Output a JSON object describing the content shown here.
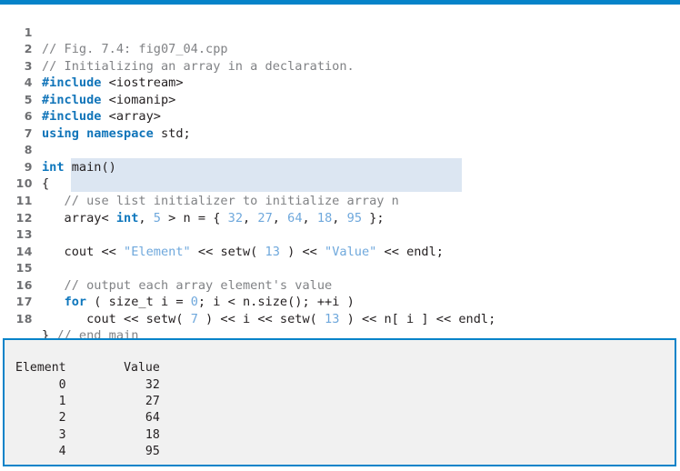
{
  "figure": {
    "caption_ref": "Fig. 7.4",
    "file_name": "fig07_04.cpp",
    "accent_color": "#0683c9",
    "highlight_color": "#dce6f2",
    "keyword_color": "#0f77bd",
    "comment_color": "#808285",
    "literal_color": "#6fa8dc",
    "output_bg_color": "#f1f1f1"
  },
  "code": {
    "line_numbers": [
      "1",
      "2",
      "3",
      "4",
      "5",
      "6",
      "7",
      "8",
      "9",
      "10",
      "11",
      "12",
      "13",
      "14",
      "15",
      "16",
      "17",
      "18"
    ],
    "lines": [
      {
        "n": "1",
        "text": "// Fig. 7.4: fig07_04.cpp"
      },
      {
        "n": "2",
        "text": "// Initializing an array in a declaration."
      },
      {
        "n": "3",
        "text": "#include <iostream>"
      },
      {
        "n": "4",
        "text": "#include <iomanip>"
      },
      {
        "n": "5",
        "text": "#include <array>"
      },
      {
        "n": "6",
        "text": "using namespace std;"
      },
      {
        "n": "7",
        "text": ""
      },
      {
        "n": "8",
        "text": "int main()"
      },
      {
        "n": "9",
        "text": "{"
      },
      {
        "n": "10",
        "text": "   // use list initializer to initialize array n"
      },
      {
        "n": "11",
        "text": "   array< int, 5 > n = { 32, 27, 64, 18, 95 };"
      },
      {
        "n": "12",
        "text": ""
      },
      {
        "n": "13",
        "text": "   cout << \"Element\" << setw( 13 ) << \"Value\" << endl;"
      },
      {
        "n": "14",
        "text": ""
      },
      {
        "n": "15",
        "text": "   // output each array element's value"
      },
      {
        "n": "16",
        "text": "   for ( size_t i = 0; i < n.size(); ++i )"
      },
      {
        "n": "17",
        "text": "      cout << setw( 7 ) << i << setw( 13 ) << n[ i ] << endl;"
      },
      {
        "n": "18",
        "text": "} // end main"
      }
    ],
    "highlighted_line_numbers": [
      "10",
      "11"
    ]
  },
  "output": {
    "headers": [
      "Element",
      "Value"
    ],
    "rows": [
      {
        "element": "0",
        "value": "32"
      },
      {
        "element": "1",
        "value": "27"
      },
      {
        "element": "2",
        "value": "64"
      },
      {
        "element": "3",
        "value": "18"
      },
      {
        "element": "4",
        "value": "95"
      }
    ],
    "text": "Element        Value\n      0           32\n      1           27\n      2           64\n      3           18\n      4           95"
  }
}
